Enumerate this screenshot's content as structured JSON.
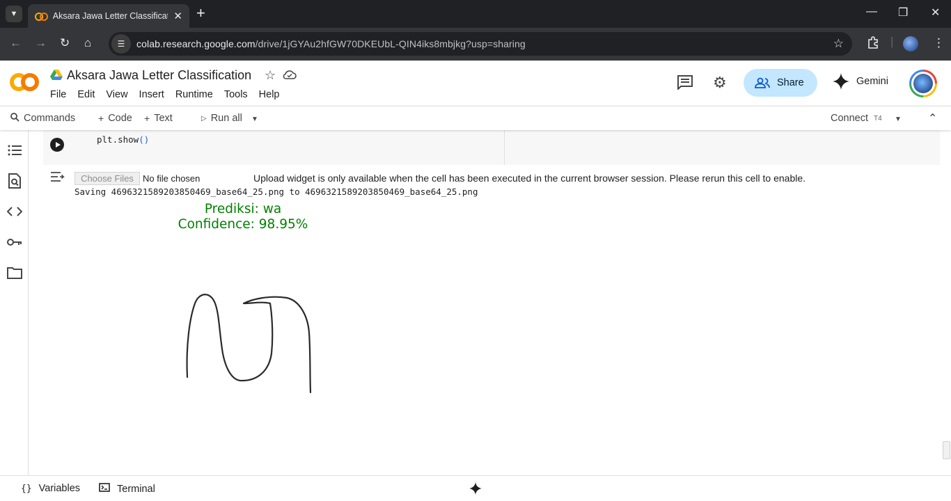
{
  "browser": {
    "tab_title": "Aksara Jawa Letter Classification",
    "url_host": "colab.research.google.com",
    "url_path": "/drive/1jGYAu2hfGW70DKEUbL-QIN4iks8mbjkg?usp=sharing"
  },
  "header": {
    "title": "Aksara Jawa Letter Classification",
    "menu": [
      "File",
      "Edit",
      "View",
      "Insert",
      "Runtime",
      "Tools",
      "Help"
    ],
    "share_label": "Share",
    "gemini_label": "Gemini"
  },
  "toolbar": {
    "commands_label": "Commands",
    "code_label": "Code",
    "text_label": "Text",
    "run_all_label": "Run all",
    "connect_label": "Connect",
    "runtime_type": "T4"
  },
  "cell": {
    "code_func": "plt.show",
    "code_parens": "()"
  },
  "output": {
    "choose_files_label": "Choose Files",
    "no_file_label": "No file chosen",
    "upload_message": "Upload widget is only available when the cell has been executed in the current browser session. Please rerun this cell to enable.",
    "saving_line": "Saving 4696321589203850469_base64_25.png to 4696321589203850469_base64_25.png",
    "prediction": "Prediksi: wa",
    "confidence": "Confidence: 98.95%",
    "prediction_color": "#008000"
  },
  "statusbar": {
    "variables_label": "Variables",
    "terminal_label": "Terminal"
  },
  "icons": {
    "left_rail": [
      "table-of-contents-icon",
      "find-replace-icon",
      "code-snippets-icon",
      "secrets-key-icon",
      "files-folder-icon"
    ]
  }
}
